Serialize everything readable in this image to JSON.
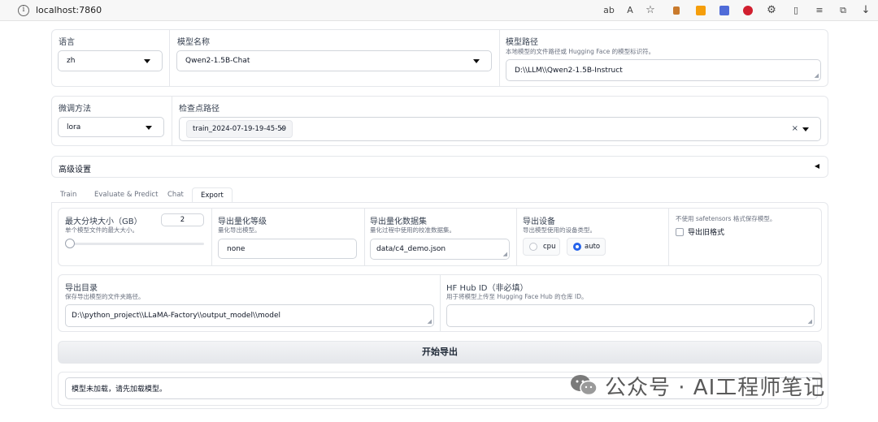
{
  "browser": {
    "url": "localhost:7860"
  },
  "top": {
    "lang": {
      "label": "语言",
      "value": "zh"
    },
    "model_name": {
      "label": "模型名称",
      "value": "Qwen2-1.5B-Chat"
    },
    "model_path": {
      "label": "模型路径",
      "info": "本地模型的文件路径或 Hugging Face 的模型标识符。",
      "value": "D:\\\\LLM\\\\Qwen2-1.5B-Instruct"
    }
  },
  "finetune": {
    "method": {
      "label": "微调方法",
      "value": "lora"
    },
    "checkpoint": {
      "label": "检查点路径",
      "chip": "train_2024-07-19-19-45-59",
      "chip_close": "×",
      "clear": "×"
    }
  },
  "advanced": {
    "label": "高级设置",
    "toggle": "◀"
  },
  "tabs": [
    {
      "label": "Train"
    },
    {
      "label": "Evaluate & Predict"
    },
    {
      "label": "Chat"
    },
    {
      "label": "Export"
    }
  ],
  "export": {
    "shard": {
      "label": "最大分块大小（GB）",
      "info": "单个模型文件的最大大小。",
      "value": "2",
      "slider_fraction": 0.0
    },
    "quant_bit": {
      "label": "导出量化等级",
      "info": "量化导出模型。",
      "value": "none"
    },
    "quant_dataset": {
      "label": "导出量化数据集",
      "info": "量化过程中使用的校准数据集。",
      "value": "data/c4_demo.json"
    },
    "device": {
      "label": "导出设备",
      "info": "导出模型使用的设备类型。",
      "options": [
        "cpu",
        "auto"
      ],
      "selected": "auto"
    },
    "legacy": {
      "info": "不使用 safetensors 格式保存模型。",
      "label": "导出旧格式",
      "checked": false
    },
    "export_dir": {
      "label": "导出目录",
      "info": "保存导出模型的文件夹路径。",
      "value": "D:\\\\python_project\\\\LLaMA-Factory\\\\output_model\\\\model"
    },
    "hub_id": {
      "label": "HF Hub ID（非必填）",
      "info": "用于将模型上传至 Hugging Face Hub 的仓库 ID。",
      "value": ""
    },
    "button": "开始导出",
    "output": "模型未加载，请先加载模型。"
  },
  "watermark": {
    "text": "公众号 · AI工程师笔记"
  },
  "colors": {
    "accent": "#2563eb",
    "border": "#e5e7eb"
  }
}
